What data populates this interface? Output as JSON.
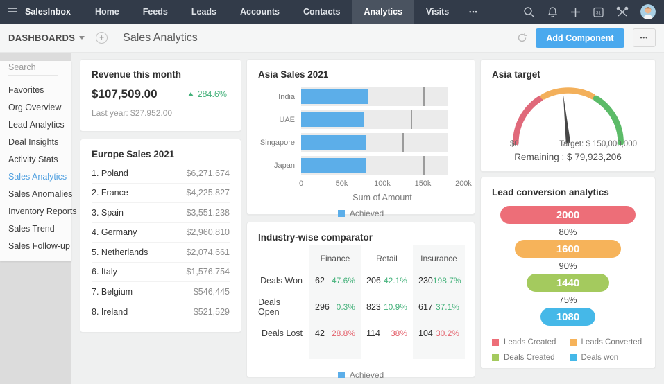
{
  "topnav": {
    "brand": "SalesInbox",
    "items": [
      "Home",
      "Feeds",
      "Leads",
      "Accounts",
      "Contacts",
      "Analytics",
      "Visits"
    ],
    "active_item": "Analytics",
    "more_label": "•••",
    "icons": [
      "search-icon",
      "notifications-icon",
      "add-icon",
      "calendar-icon",
      "setup-icon",
      "avatar"
    ]
  },
  "subheader": {
    "dashboards_label": "DASHBOARDS",
    "title": "Sales Analytics",
    "add_component_label": "Add Component",
    "more_label": "•••"
  },
  "sidebar": {
    "search_placeholder": "Search",
    "items": [
      "Favorites",
      "Org Overview",
      "Lead Analytics",
      "Deal Insights",
      "Activity Stats",
      "Sales Analytics",
      "Sales Anomalies",
      "Inventory Reports",
      "Sales Trend",
      "Sales Follow-up"
    ],
    "active_item": "Sales Analytics"
  },
  "revenue_card": {
    "title": "Revenue this month",
    "amount": "$107,509.00",
    "delta": "284.6%",
    "delta_direction": "up",
    "last_year_label": "Last year:",
    "last_year_value": "$27.952.00"
  },
  "europe_card": {
    "title": "Europe Sales 2021",
    "rows": [
      {
        "rank": "1.",
        "name": "Poland",
        "value": "$6,271.674"
      },
      {
        "rank": "2.",
        "name": "France",
        "value": "$4,225.827"
      },
      {
        "rank": "3.",
        "name": "Spain",
        "value": "$3,551.238"
      },
      {
        "rank": "4.",
        "name": "Germany",
        "value": "$2,960.810"
      },
      {
        "rank": "5.",
        "name": "Netherlands",
        "value": "$2,074.661"
      },
      {
        "rank": "6.",
        "name": "Italy",
        "value": "$1,576.754"
      },
      {
        "rank": "7.",
        "name": "Belgium",
        "value": "$546,445"
      },
      {
        "rank": "8.",
        "name": "Ireland",
        "value": "$521,529"
      }
    ]
  },
  "chart_data": [
    {
      "type": "bar",
      "subtype": "bullet-horizontal",
      "title": "Asia Sales 2021",
      "categories": [
        "India",
        "UAE",
        "Singapore",
        "Japan"
      ],
      "series": [
        {
          "name": "Achieved",
          "values": [
            82000,
            77000,
            80000,
            80000
          ]
        }
      ],
      "target_markers": [
        150000,
        135000,
        125000,
        150000
      ],
      "track_max": 180000,
      "xlim": [
        0,
        200000
      ],
      "x_ticks": [
        "0",
        "50k",
        "100k",
        "150k",
        "200k"
      ],
      "xlabel": "Sum of Amount",
      "legend": [
        "Achieved"
      ],
      "bar_color": "#5caee9",
      "track_color": "#ebebeb"
    },
    {
      "type": "table",
      "title": "Industry-wise comparator",
      "columns": [
        "Finance",
        "Retail",
        "Insurance"
      ],
      "rows": [
        {
          "label": "Deals Won",
          "cells": [
            {
              "value": "62",
              "delta": "47.6%",
              "direction": "up"
            },
            {
              "value": "206",
              "delta": "42.1%",
              "direction": "up"
            },
            {
              "value": "230",
              "delta": "198.7%",
              "direction": "up"
            }
          ]
        },
        {
          "label": "Deals Open",
          "cells": [
            {
              "value": "296",
              "delta": "0.3%",
              "direction": "up"
            },
            {
              "value": "823",
              "delta": "10.9%",
              "direction": "up"
            },
            {
              "value": "617",
              "delta": "37.1%",
              "direction": "up"
            }
          ]
        },
        {
          "label": "Deals Lost",
          "cells": [
            {
              "value": "42",
              "delta": "28.8%",
              "direction": "down"
            },
            {
              "value": "114",
              "delta": "38%",
              "direction": "down"
            },
            {
              "value": "104",
              "delta": "30.2%",
              "direction": "down"
            }
          ]
        }
      ],
      "legend": [
        "Achieved"
      ],
      "legend_color": "#5caee9",
      "up_color": "#45b27b",
      "down_color": "#e4606b"
    },
    {
      "type": "gauge",
      "title": "Asia target",
      "min_label": "$0",
      "target_label": "Target: $ 150,000,000",
      "remaining_label": "Remaining : $ 79,923,206",
      "value": 70076794,
      "max": 150000000,
      "segment_colors": [
        "#e0697a",
        "#f3b05b",
        "#5cbb68"
      ],
      "needle_color": "#474747"
    },
    {
      "type": "funnel",
      "title": "Lead conversion analytics",
      "stages": [
        {
          "label": "Leads Created",
          "value": "2000",
          "color": "#ed6e78"
        },
        {
          "label": "Leads Converted",
          "value": "1600",
          "color": "#f6b35a"
        },
        {
          "label": "Deals Created",
          "value": "1440",
          "color": "#a4ca5e"
        },
        {
          "label": "Deals won",
          "value": "1080",
          "color": "#45b8e8"
        }
      ],
      "conversion_rates": [
        "80%",
        "90%",
        "75%"
      ]
    }
  ]
}
